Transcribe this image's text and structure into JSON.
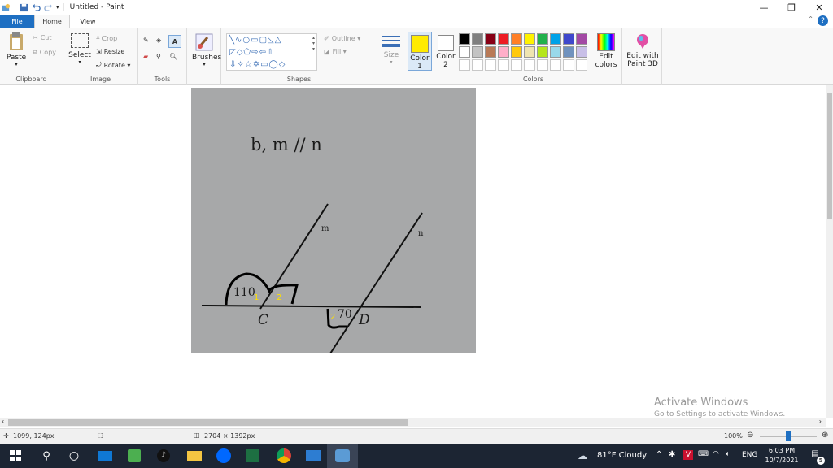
{
  "window": {
    "title": "Untitled - Paint",
    "controls": {
      "minimize": "—",
      "restore": "❐",
      "close": "✕"
    }
  },
  "tabs": {
    "file": "File",
    "home": "Home",
    "view": "View"
  },
  "help": "?",
  "ribbon": {
    "clipboard": {
      "label": "Clipboard",
      "paste": "Paste",
      "cut": "Cut",
      "copy": "Copy"
    },
    "image": {
      "label": "Image",
      "select": "Select",
      "crop": "Crop",
      "resize": "Resize",
      "rotate": "Rotate ▾"
    },
    "tools": {
      "label": "Tools"
    },
    "brushes": {
      "label": "Brushes"
    },
    "shapes": {
      "label": "Shapes",
      "outline": "Outline ▾",
      "fill": "Fill ▾"
    },
    "size": {
      "label": "Size"
    },
    "color1": {
      "line1": "Color",
      "line2": "1",
      "value": "#ffeb00"
    },
    "color2": {
      "line1": "Color",
      "line2": "2",
      "value": "#ffffff"
    },
    "colors": {
      "label": "Colors",
      "edit_line1": "Edit",
      "edit_line2": "colors",
      "paint3d_line1": "Edit with",
      "paint3d_line2": "Paint 3D",
      "palette_row1": [
        "#000000",
        "#7f7f7f",
        "#880015",
        "#ed1c24",
        "#ff7f27",
        "#fff200",
        "#22b14c",
        "#00a2e8",
        "#3f48cc",
        "#a349a4"
      ],
      "palette_row2": [
        "#ffffff",
        "#c3c3c3",
        "#b97a57",
        "#ffaec9",
        "#ffc90e",
        "#efe4b0",
        "#b5e61d",
        "#99d9ea",
        "#7092be",
        "#c8bfe7"
      ]
    }
  },
  "image_content": {
    "heading": "b, m // n",
    "label_m": "m",
    "label_n": "n",
    "angle_110": "110",
    "marker_1": "1",
    "marker_2_top": "2",
    "point_c": "C",
    "marker_2_bottom": "2",
    "angle_70": "70",
    "point_d": "D"
  },
  "watermark": {
    "line1": "Activate Windows",
    "line2": "Go to Settings to activate Windows."
  },
  "statusbar": {
    "cursor": "1099, 124px",
    "dimensions": "2704 × 1392px",
    "zoom": "100%"
  },
  "taskbar": {
    "weather": "81°F  Cloudy",
    "language": "ENG",
    "time": "6:03 PM",
    "date": "10/7/2021",
    "notifications": "5"
  }
}
